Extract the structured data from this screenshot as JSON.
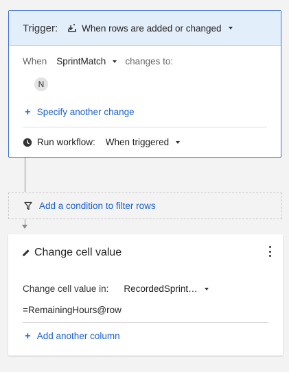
{
  "trigger": {
    "title": "Trigger:",
    "selected": "When rows are added or changed",
    "icon": "rows-added-icon"
  },
  "when": {
    "label": "When",
    "column": "SprintMatch",
    "changes_to": "changes to:",
    "values": [
      "N"
    ]
  },
  "specify_link": "Specify another change",
  "run": {
    "label": "Run workflow:",
    "selected": "When triggered"
  },
  "condition": {
    "label": "Add a condition to filter rows"
  },
  "action": {
    "title": "Change cell value",
    "change_in_label": "Change cell value in:",
    "change_in_value": "RecordedSprint…",
    "formula": "=RemainingHours@row",
    "add_column": "Add another column"
  },
  "colors": {
    "accent": "#1a5fcf",
    "header_bg": "#e3eefb",
    "border": "#3b6fd6"
  }
}
